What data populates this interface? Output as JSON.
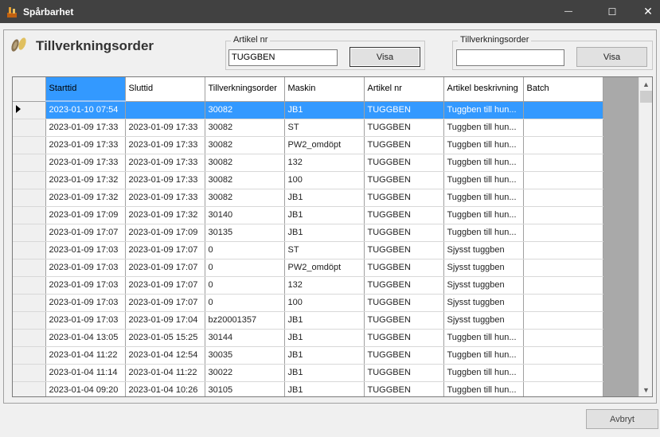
{
  "window": {
    "title": "Spårbarhet",
    "minimize_glyph": "—",
    "maximize_glyph": "☐",
    "close_glyph": "✕"
  },
  "header": {
    "title": "Tillverkningsorder"
  },
  "filter_artikel": {
    "legend": "Artikel nr",
    "value": "TUGGBEN",
    "button": "Visa"
  },
  "filter_order": {
    "legend": "Tillverkningsorder",
    "value": "",
    "button": "Visa"
  },
  "footer": {
    "cancel_label": "Avbryt"
  },
  "grid": {
    "columns": [
      "Starttid",
      "Sluttid",
      "Tillverkningsorder",
      "Maskin",
      "Artikel nr",
      "Artikel beskrivning",
      "Batch"
    ],
    "rows": [
      [
        "2023-01-10 07:54",
        "",
        "30082",
        "JB1",
        "TUGGBEN",
        "Tuggben till hun...",
        ""
      ],
      [
        "2023-01-09 17:33",
        "2023-01-09 17:33",
        "30082",
        "ST",
        "TUGGBEN",
        "Tuggben till hun...",
        ""
      ],
      [
        "2023-01-09 17:33",
        "2023-01-09 17:33",
        "30082",
        "PW2_omdöpt",
        "TUGGBEN",
        "Tuggben till hun...",
        ""
      ],
      [
        "2023-01-09 17:33",
        "2023-01-09 17:33",
        "30082",
        "132",
        "TUGGBEN",
        "Tuggben till hun...",
        ""
      ],
      [
        "2023-01-09 17:32",
        "2023-01-09 17:33",
        "30082",
        "100",
        "TUGGBEN",
        "Tuggben till hun...",
        ""
      ],
      [
        "2023-01-09 17:32",
        "2023-01-09 17:33",
        "30082",
        "JB1",
        "TUGGBEN",
        "Tuggben till hun...",
        ""
      ],
      [
        "2023-01-09 17:09",
        "2023-01-09 17:32",
        "30140",
        "JB1",
        "TUGGBEN",
        "Tuggben till hun...",
        ""
      ],
      [
        "2023-01-09 17:07",
        "2023-01-09 17:09",
        "30135",
        "JB1",
        "TUGGBEN",
        "Tuggben till hun...",
        ""
      ],
      [
        "2023-01-09 17:03",
        "2023-01-09 17:07",
        "0",
        "ST",
        "TUGGBEN",
        "Sjysst tuggben",
        ""
      ],
      [
        "2023-01-09 17:03",
        "2023-01-09 17:07",
        "0",
        "PW2_omdöpt",
        "TUGGBEN",
        "Sjysst tuggben",
        ""
      ],
      [
        "2023-01-09 17:03",
        "2023-01-09 17:07",
        "0",
        "132",
        "TUGGBEN",
        "Sjysst tuggben",
        ""
      ],
      [
        "2023-01-09 17:03",
        "2023-01-09 17:07",
        "0",
        "100",
        "TUGGBEN",
        "Sjysst tuggben",
        ""
      ],
      [
        "2023-01-09 17:03",
        "2023-01-09 17:04",
        "bz20001357",
        "JB1",
        "TUGGBEN",
        "Sjysst tuggben",
        ""
      ],
      [
        "2023-01-04 13:05",
        "2023-01-05 15:25",
        "30144",
        "JB1",
        "TUGGBEN",
        "Tuggben till hun...",
        ""
      ],
      [
        "2023-01-04 11:22",
        "2023-01-04 12:54",
        "30035",
        "JB1",
        "TUGGBEN",
        "Tuggben till hun...",
        ""
      ],
      [
        "2023-01-04 11:14",
        "2023-01-04 11:22",
        "30022",
        "JB1",
        "TUGGBEN",
        "Tuggben till hun...",
        ""
      ],
      [
        "2023-01-04 09:20",
        "2023-01-04 10:26",
        "30105",
        "JB1",
        "TUGGBEN",
        "Tuggben till hun...",
        ""
      ]
    ]
  },
  "colors": {
    "selection": "#3399ff",
    "titlebar": "#414141"
  }
}
